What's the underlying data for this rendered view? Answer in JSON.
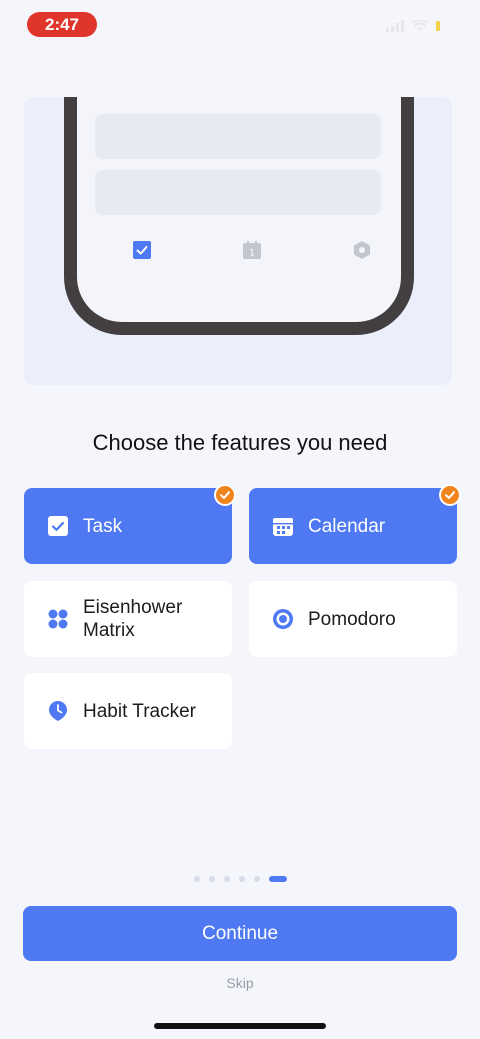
{
  "status_bar": {
    "time": "2:47"
  },
  "headline": "Choose the features you need",
  "features": [
    {
      "label": "Task",
      "selected": true,
      "icon": "checkbox-icon"
    },
    {
      "label": "Calendar",
      "selected": true,
      "icon": "calendar-icon"
    },
    {
      "label": "Eisenhower Matrix",
      "selected": false,
      "icon": "matrix-icon"
    },
    {
      "label": "Pomodoro",
      "selected": false,
      "icon": "pomodoro-icon"
    },
    {
      "label": "Habit Tracker",
      "selected": false,
      "icon": "habit-icon"
    }
  ],
  "pager": {
    "total": 6,
    "current": 6
  },
  "continue_label": "Continue",
  "skip_label": "Skip",
  "colors": {
    "accent": "#4f79f2",
    "badge": "#f0851e",
    "background": "#f5f6fc"
  }
}
